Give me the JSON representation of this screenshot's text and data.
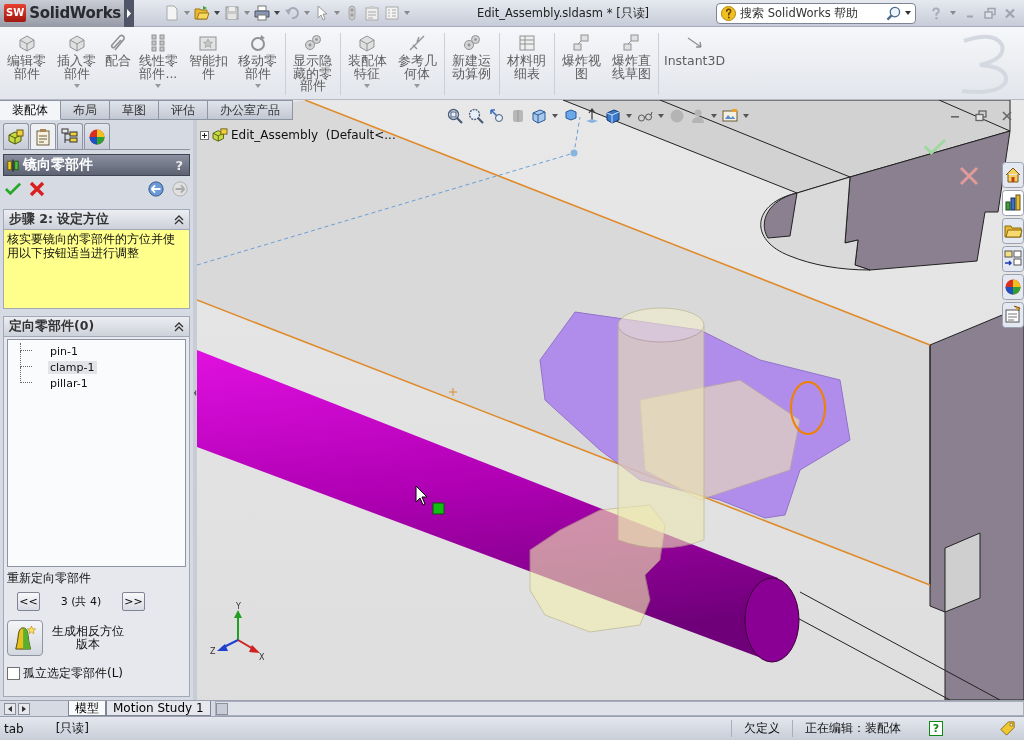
{
  "title_bar": {
    "logo_mark": "SW",
    "app_name": "SolidWorks",
    "document": "Edit_Assembly.sldasm * [只读]",
    "search": {
      "placeholder": "搜索 SolidWorks 帮助"
    }
  },
  "ribbon": [
    {
      "items": [
        {
          "label": "编辑零部件",
          "dropdown": false,
          "disabled": true
        },
        {
          "label": "插入零部件",
          "dropdown": true,
          "disabled": true
        },
        {
          "label": "配合",
          "dropdown": false,
          "disabled": true
        },
        {
          "label": "线性零部件...",
          "dropdown": true,
          "disabled": true
        },
        {
          "label": "智能扣件",
          "dropdown": false,
          "disabled": true
        },
        {
          "label": "移动零部件",
          "dropdown": true,
          "disabled": true
        }
      ]
    },
    {
      "items": [
        {
          "label": "显示隐藏的零部件",
          "dropdown": false,
          "disabled": true
        }
      ]
    },
    {
      "items": [
        {
          "label": "装配体特征",
          "dropdown": true,
          "disabled": true
        },
        {
          "label": "参考几何体",
          "dropdown": true,
          "disabled": true
        }
      ]
    },
    {
      "items": [
        {
          "label": "新建运动算例",
          "dropdown": false,
          "disabled": true
        }
      ]
    },
    {
      "items": [
        {
          "label": "材料明细表",
          "dropdown": false,
          "disabled": true
        }
      ]
    },
    {
      "items": [
        {
          "label": "爆炸视图",
          "dropdown": false,
          "disabled": true
        },
        {
          "label": "爆炸直线草图",
          "dropdown": false,
          "disabled": true
        }
      ]
    },
    {
      "items": [
        {
          "label": "Instant3D",
          "dropdown": false,
          "disabled": true
        }
      ]
    }
  ],
  "command_tabs": [
    {
      "label": "装配体",
      "selected": true
    },
    {
      "label": "布局",
      "selected": false
    },
    {
      "label": "草图",
      "selected": false
    },
    {
      "label": "评估",
      "selected": false
    },
    {
      "label": "办公室产品",
      "selected": false
    }
  ],
  "panel_tabs": [
    {
      "selected": false
    },
    {
      "selected": true
    },
    {
      "selected": false
    },
    {
      "selected": false
    }
  ],
  "property_manager": {
    "title": "镜向零部件",
    "help": "?",
    "step_group": {
      "title": "步骤 2: 设定方位",
      "expanded": true,
      "message": "核实要镜向的零部件的方位并使用以下按钮适当进行调整"
    },
    "orient_group": {
      "title": "定向零部件(0)",
      "expanded": true,
      "components": [
        {
          "label": "pin-1",
          "selected": false
        },
        {
          "label": "clamp-1",
          "selected": true
        },
        {
          "label": "pillar-1",
          "selected": false
        }
      ],
      "reorient_label": "重新定向零部件",
      "previous": "<<",
      "counter": "3 (共 4)",
      "next": ">>",
      "opposite_label": "生成相反方位版本",
      "isolate": {
        "label": "孤立选定零部件(L)",
        "checked": false
      }
    }
  },
  "feature_tree": {
    "expanded": false,
    "label": "Edit_Assembly  (Default<..."
  },
  "triad": {
    "x": "X",
    "y": "Y",
    "z": "Z"
  },
  "bottom_tabs": [
    {
      "label": "模型",
      "selected": true
    },
    {
      "label": "Motion Study 1",
      "selected": false
    }
  ],
  "status_bar": {
    "left": [
      "tab",
      "[只读]"
    ],
    "right": [
      "欠定义",
      "正在编辑：装配体"
    ],
    "help": "?"
  }
}
